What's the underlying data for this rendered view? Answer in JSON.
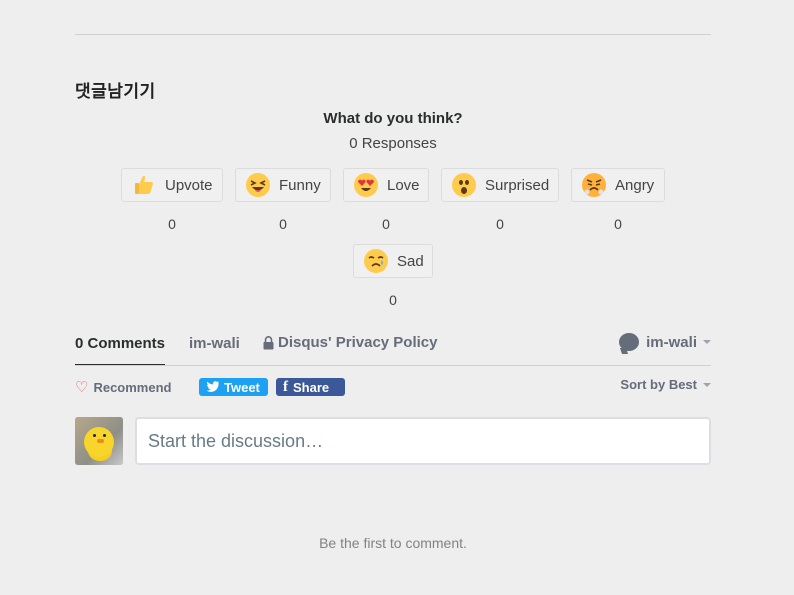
{
  "section_title": "댓글남기기",
  "reactions_header": {
    "question": "What do you think?",
    "responses": "0 Responses"
  },
  "reactions": [
    {
      "label": "Upvote",
      "count": "0",
      "icon": "thumbs-up-icon"
    },
    {
      "label": "Funny",
      "count": "0",
      "icon": "laughing-face-icon"
    },
    {
      "label": "Love",
      "count": "0",
      "icon": "heart-eyes-face-icon"
    },
    {
      "label": "Surprised",
      "count": "0",
      "icon": "surprised-face-icon"
    },
    {
      "label": "Angry",
      "count": "0",
      "icon": "angry-face-icon"
    },
    {
      "label": "Sad",
      "count": "0",
      "icon": "sad-face-icon"
    }
  ],
  "tabs": {
    "comments": "0 Comments",
    "community": "im-wali",
    "privacy": "Disqus' Privacy Policy"
  },
  "user_menu": {
    "name": "im-wali"
  },
  "actions": {
    "recommend": "Recommend",
    "tweet": "Tweet",
    "share": "Share",
    "sort": "Sort by Best"
  },
  "composer": {
    "placeholder": "Start the discussion…"
  },
  "empty_state": "Be the first to comment.",
  "colors": {
    "background": "#eeeeee",
    "tweet": "#1da1f2",
    "facebook": "#3b5998",
    "heart": "#e25c6a",
    "muted": "#656c7a"
  }
}
